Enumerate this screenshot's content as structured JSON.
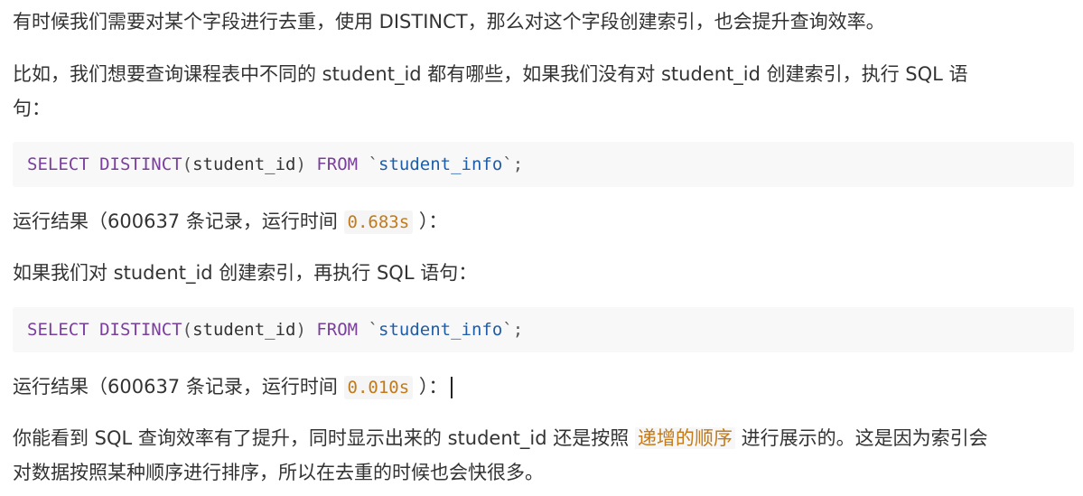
{
  "paragraphs": {
    "p1": "有时候我们需要对某个字段进行去重，使用 DISTINCT，那么对这个字段创建索引，也会提升查询效率。",
    "p2_line1": "比如，我们想要查询课程表中不同的 student_id 都有哪些，如果我们没有对 student_id 创建索引，执行 SQL 语",
    "p2_line2": "句：",
    "p3_pre": "运行结果（600637 条记录，运行时间 ",
    "p3_time": "0.683s",
    "p3_post": " ）：",
    "p4": "如果我们对 student_id 创建索引，再执行 SQL 语句：",
    "p5_pre": "运行结果（600637 条记录，运行时间 ",
    "p5_time": "0.010s",
    "p5_post": " ）：",
    "p6_line1_pre": "你能看到 SQL 查询效率有了提升，同时显示出来的 student_id 还是按照 ",
    "p6_highlight": "递增的顺序",
    "p6_line1_post": " 进行展示的。这是因为索引会",
    "p6_line2": "对数据按照某种顺序进行排序，所以在去重的时候也会快很多。"
  },
  "code": {
    "kw_select": "SELECT",
    "fn_distinct": "DISTINCT",
    "paren_open": "(",
    "column": "student_id",
    "paren_close": ")",
    "kw_from": "FROM",
    "backtick_open": "`",
    "table": "student_info",
    "backtick_close": "`",
    "semicolon": ";"
  },
  "colors": {
    "keyword": "#7a3e9d",
    "string": "#1f5da8",
    "inline_code": "#c27a1a"
  }
}
